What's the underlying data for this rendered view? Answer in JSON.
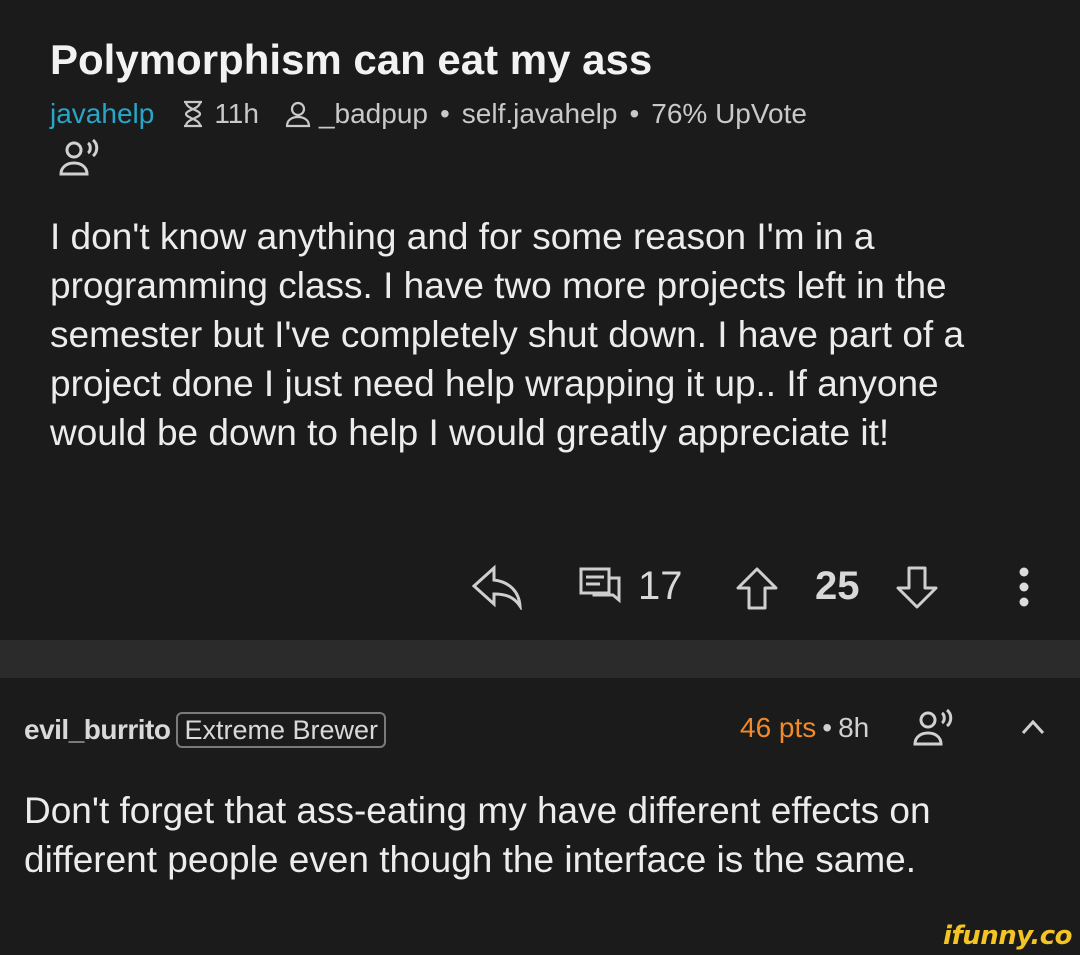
{
  "post": {
    "title": "Polymorphism can eat my ass",
    "subreddit": "javahelp",
    "age": "11h",
    "author": "_badpup",
    "domain": "self.javahelp",
    "upvote_ratio": "76% UpVote",
    "separator": "•",
    "body": "I don't know anything and for some reason I'm in a programming class. I have two more projects left in the semester but I've completely shut down. I have part of a project done I just need help wrapping it up.. If anyone would be down to help I would greatly appreciate it!",
    "comment_count": "17",
    "score": "25",
    "icons": [
      "hourglass-icon",
      "user-icon",
      "listen-icon",
      "reply-icon",
      "comment-icon",
      "upvote-icon",
      "downvote-icon",
      "more-icon"
    ]
  },
  "comment": {
    "author": "evil_burrito",
    "flair": "Extreme Brewer",
    "points": "46 pts",
    "separator": "•",
    "age": "8h",
    "body": "Don't forget that ass-eating my have different effects on different people even though the interface is the same.",
    "icons": [
      "listen-icon",
      "collapse-icon"
    ]
  },
  "watermark": "ifunny.co",
  "colors": {
    "background": "#1b1b1b",
    "divider": "#2b2b2b",
    "subreddit": "#27a7c7",
    "points": "#f08a2a",
    "watermark": "#f3c424"
  }
}
